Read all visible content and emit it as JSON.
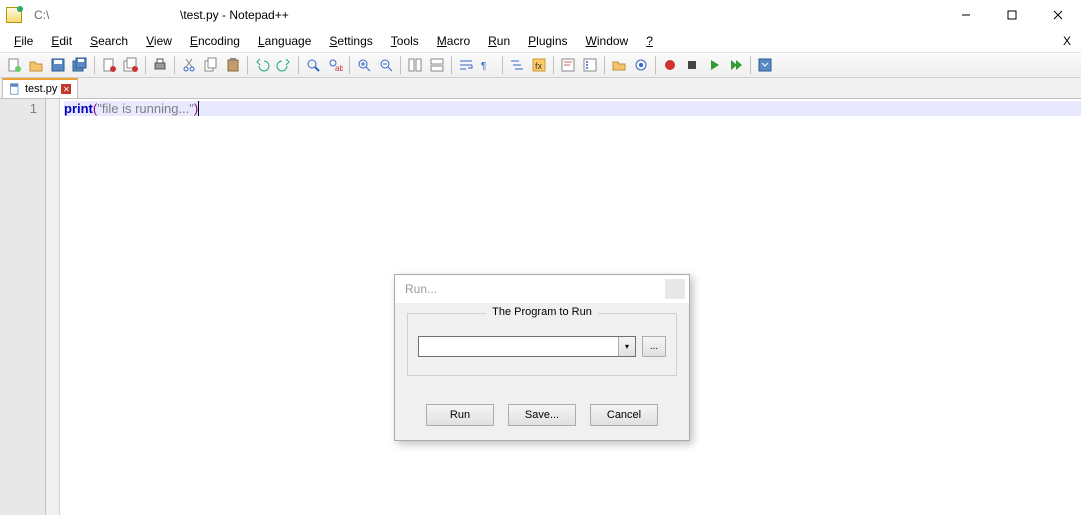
{
  "titlebar": {
    "path": "C:\\",
    "title": "\\test.py - Notepad++"
  },
  "menu": {
    "items": [
      {
        "ul": "F",
        "rest": "ile"
      },
      {
        "ul": "E",
        "rest": "dit"
      },
      {
        "ul": "S",
        "rest": "earch"
      },
      {
        "ul": "V",
        "rest": "iew"
      },
      {
        "ul": "E",
        "pre": "",
        "rest": "ncoding"
      },
      {
        "ul": "L",
        "rest": "anguage"
      },
      {
        "ul": "S",
        "pre": "",
        "rest": "ettings"
      },
      {
        "ul": "T",
        "rest": "ools"
      },
      {
        "ul": "M",
        "rest": "acro"
      },
      {
        "ul": "R",
        "rest": "un"
      },
      {
        "ul": "P",
        "rest": "lugins"
      },
      {
        "ul": "W",
        "rest": "indow"
      },
      {
        "ul": "?",
        "rest": ""
      }
    ],
    "overflow": "X"
  },
  "tab": {
    "label": "test.py"
  },
  "editor": {
    "line_number": "1",
    "code": {
      "kw": "print",
      "open": "(",
      "str": "\"file is running...\"",
      "close": ")"
    }
  },
  "dialog": {
    "title": "Run...",
    "legend": "The Program to Run",
    "program_value": "",
    "browse": "...",
    "buttons": {
      "run": "Run",
      "save": "Save...",
      "cancel": "Cancel"
    }
  },
  "toolbar_icons": [
    "new-file",
    "open-file",
    "save",
    "save-all",
    "sep",
    "close",
    "close-all",
    "sep",
    "print",
    "sep",
    "cut",
    "copy",
    "paste",
    "sep",
    "undo",
    "redo",
    "sep",
    "find",
    "replace",
    "sep",
    "zoom-in",
    "zoom-out",
    "sep",
    "sync-v",
    "sync-h",
    "sep",
    "wrap",
    "all-chars",
    "sep",
    "indent-guide",
    "lang",
    "sep",
    "doc-map",
    "func-list",
    "sep",
    "folder",
    "monitor",
    "sep",
    "record",
    "stop",
    "play",
    "play-multi",
    "sep",
    "save-macro"
  ]
}
